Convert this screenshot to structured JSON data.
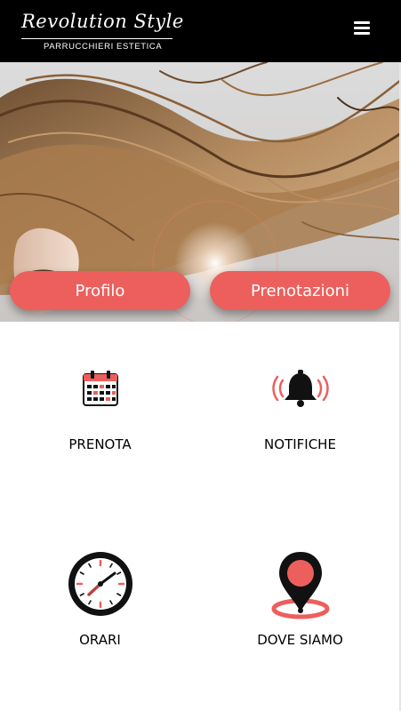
{
  "header": {
    "logo_main": "Revolution Style",
    "logo_sub": "PARRUCCHIERI ESTETICA",
    "menu_icon": "hamburger-menu-icon"
  },
  "hero": {
    "image": "flowing-hair-photo",
    "buttons": {
      "profilo": "Profilo",
      "prenotazioni": "Prenotazioni"
    }
  },
  "tiles": [
    {
      "label": "PRENOTA",
      "icon": "calendar-icon"
    },
    {
      "label": "NOTIFICHE",
      "icon": "bell-icon"
    },
    {
      "label": "ORARI",
      "icon": "clock-icon"
    },
    {
      "label": "DOVE SIAMO",
      "icon": "location-pin-icon"
    }
  ],
  "colors": {
    "accent": "#ec5f5c",
    "header_bg": "#000000",
    "background": "#ffffff"
  }
}
